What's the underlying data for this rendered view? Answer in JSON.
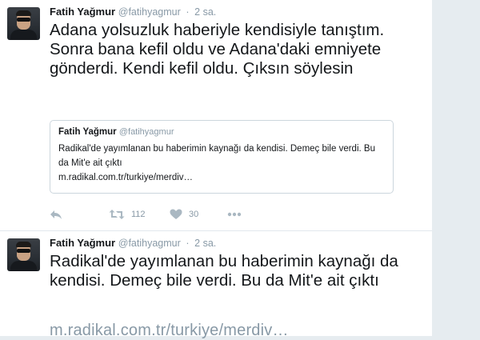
{
  "tweets": [
    {
      "author_name": "Fatih Yağmur",
      "author_handle": "@fatihyagmur",
      "separator": "·",
      "time": "2 sa.",
      "text": "Adana yolsuzluk haberiyle kendisiyle tanıştım. Sonra bana kefil oldu ve Adana'daki emniyete gönderdi. Kendi kefil oldu. Çıksın söylesin",
      "quote": {
        "author_name": "Fatih Yağmur",
        "author_handle": "@fatihyagmur",
        "text": "Radikal'de yayımlanan bu haberimin kaynağı da kendisi. Demeç bile verdi. Bu da Mit'e ait çıktı",
        "link": "m.radikal.com.tr/turkiye/merdiv…"
      },
      "actions": {
        "retweet_count": "112",
        "like_count": "30"
      }
    },
    {
      "author_name": "Fatih Yağmur",
      "author_handle": "@fatihyagmur",
      "separator": "·",
      "time": "2 sa.",
      "text": "Radikal'de yayımlanan bu haberimin kaynağı da kendisi. Demeç bile verdi. Bu da Mit'e ait çıktı",
      "link": "m.radikal.com.tr/turkiye/merdiv…"
    }
  ],
  "icons": {
    "reply": "reply-icon",
    "retweet": "retweet-icon",
    "like": "heart-icon",
    "more": "more-icon"
  },
  "colors": {
    "name": "#14171a",
    "muted": "#8899a6",
    "icon": "#aab8c2",
    "border": "#e1e8ed"
  }
}
